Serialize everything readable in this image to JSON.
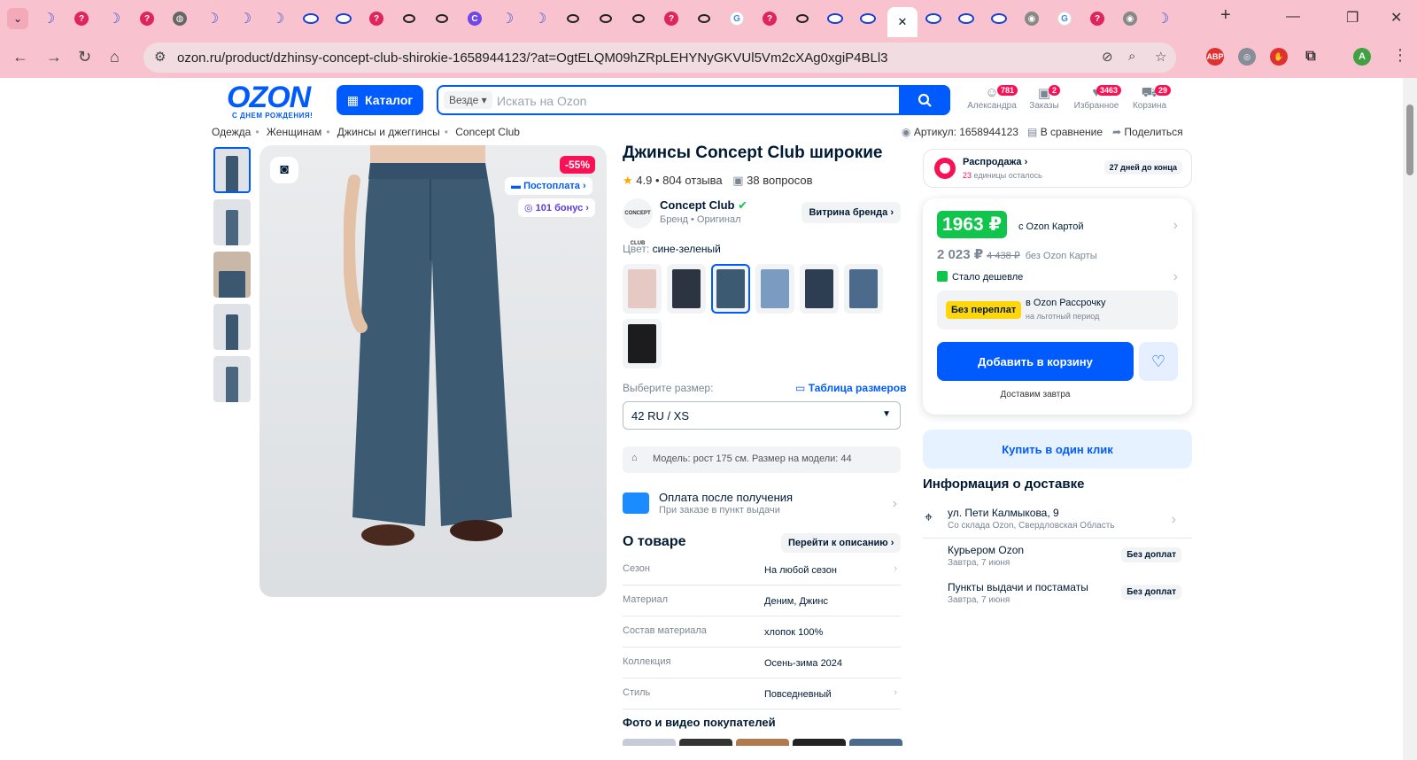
{
  "browser": {
    "tabs_menu_icon": "chevron-down-icon",
    "tab_icons": [
      "moon",
      "q",
      "moon",
      "q",
      "globe",
      "moon",
      "moon",
      "moon",
      "ozon",
      "ozon",
      "q",
      "ring",
      "ring",
      "c",
      "moon",
      "moon",
      "ring",
      "ring",
      "ring",
      "q",
      "ring",
      "g",
      "q",
      "ring",
      "ozon",
      "ozon",
      "close",
      "ozon",
      "ozon",
      "ozon",
      "chrome",
      "g",
      "q",
      "chrome",
      "moon"
    ],
    "new_tab": "+",
    "url": "ozon.ru/product/dzhinsy-concept-club-shirokie-1658944123/?at=OgtELQM09hZRpLEHYNyGKVUl5Vm2cXAg0xgiP4BLl3",
    "extensions": [
      "ABP"
    ],
    "profile_initial": "A"
  },
  "header": {
    "logo_text": "OZON",
    "logo_sub": "С ДНЕМ РОЖДЕНИЯ!",
    "catalog_label": "Каталог",
    "search_scope": "Везде",
    "search_placeholder": "Искать на Ozon",
    "icons": [
      {
        "label": "Александра",
        "badge": "781"
      },
      {
        "label": "Заказы",
        "badge": "2"
      },
      {
        "label": "Избранное",
        "badge": "3463"
      },
      {
        "label": "Корзина",
        "badge": "29"
      }
    ]
  },
  "breadcrumbs": [
    "Одежда",
    "Женщинам",
    "Джинсы и джеггинсы",
    "Concept Club"
  ],
  "meta": {
    "article": "Артикул: 1658944123",
    "compare": "В сравнение",
    "share": "Поделиться"
  },
  "gallery": {
    "discount": "-55%",
    "postpay": "Постоплата",
    "bonus": "101 бонус"
  },
  "product": {
    "title": "Джинсы Concept Club широкие",
    "rating": "4.9 • 804 отзыва",
    "questions": "38 вопросов",
    "brand_logo_text": "CONCEPT CLUB",
    "brand_name": "Concept Club",
    "brand_sub": "Бренд • Оригинал",
    "storefront": "Витрина бренда",
    "color_label": "Цвет:",
    "color_value": "сине-зеленый",
    "size_label": "Выберите размер:",
    "size_table": "Таблица размеров",
    "size_value": "42 RU / XS",
    "model_info": "Модель: рост 175 см. Размер на модели: 44",
    "pay_title": "Оплата после получения",
    "pay_sub": "При заказе в пункт выдачи",
    "about_title": "О товаре",
    "about_link": "Перейти к описанию",
    "specs": [
      {
        "k": "Сезон",
        "v": "На любой сезон"
      },
      {
        "k": "Материал",
        "v": "Деним, Джинс"
      },
      {
        "k": "Состав материала",
        "v": "хлопок 100%"
      },
      {
        "k": "Коллекция",
        "v": "Осень-зима 2024"
      },
      {
        "k": "Стиль",
        "v": "Повседневный"
      }
    ],
    "photos_title": "Фото и видео покупателей"
  },
  "price": {
    "promo_title": "Распродажа",
    "promo_left_count": "23",
    "promo_left_text": "единицы осталось",
    "promo_days": "27 дней до конца",
    "card_price": "1963 ₽",
    "card_price_label": "с Ozon Картой",
    "price": "2 023 ₽",
    "old_price": "4 438 ₽",
    "price_label": "без Ozon Карты",
    "cheaper": "Стало дешевле",
    "installment_tag": "Без переплат",
    "installment_a": "в Ozon Рассрочку",
    "installment_b": "на льготный период",
    "add_to_cart": "Добавить в корзину",
    "deliver": "Доставим завтра",
    "one_click": "Купить в один клик"
  },
  "delivery": {
    "title": "Информация о доставке",
    "address": "ул. Пети Калмыкова, 9",
    "address_sub": "Со склада Ozon, Свердловская Область",
    "rows": [
      {
        "name": "Курьером Ozon",
        "date": "Завтра, 7 июня",
        "tag": "Без доплат"
      },
      {
        "name": "Пункты выдачи и постаматы",
        "date": "Завтра, 7 июня",
        "tag": "Без доплат"
      }
    ]
  }
}
